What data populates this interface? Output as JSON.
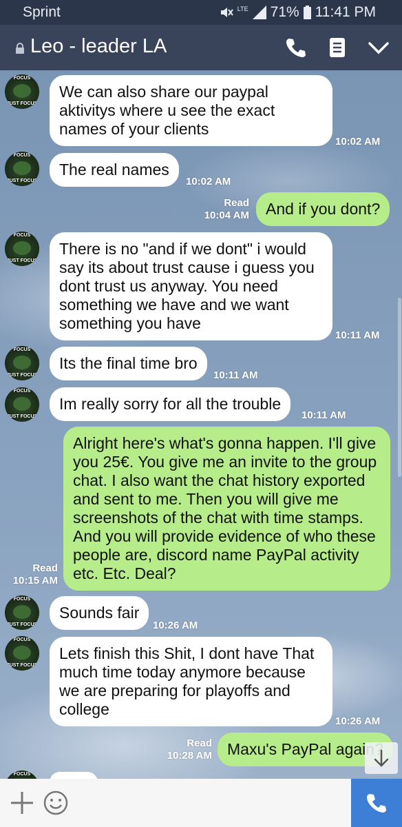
{
  "status_bar": {
    "carrier": "Sprint",
    "network": "LTE",
    "battery": "71%",
    "time": "11:41 PM"
  },
  "header": {
    "title": "Leo - leader LA",
    "icons": [
      "lock-icon",
      "phone-icon",
      "notes-icon",
      "chevron-down-icon"
    ]
  },
  "avatar": {
    "top_text": "FOCUS",
    "bottom_text": "JUST FOCUS"
  },
  "messages": [
    {
      "dir": "in",
      "text": "We can also share our paypal aktivitys where u see the exact names of your clients",
      "time": "10:02 AM"
    },
    {
      "dir": "in",
      "text": "The real names",
      "time": "10:02 AM"
    },
    {
      "dir": "out",
      "text": "And if you dont?",
      "read": "Read",
      "time": "10:04 AM"
    },
    {
      "dir": "in",
      "text": "There is no \"and if we dont\" i would say its about trust cause i guess you dont trust us anyway. You need something we have and we want something you have",
      "time": "10:11 AM"
    },
    {
      "dir": "in",
      "text": "Its the final time bro",
      "time": "10:11 AM"
    },
    {
      "dir": "in",
      "text": "Im really sorry for all the trouble",
      "time": "10:11 AM"
    },
    {
      "dir": "out",
      "text": "Alright here's what's gonna happen. I'll give you 25€.  You give me an invite to the group chat.  I also want the chat history exported and sent to me.  Then you will give me screenshots of the chat with time stamps.  And you will provide evidence of who these people are, discord name PayPal activity etc. Etc.  Deal?",
      "read": "Read",
      "time": "10:15 AM"
    },
    {
      "dir": "in",
      "text": "Sounds fair",
      "time": "10:26 AM"
    },
    {
      "dir": "in",
      "text": "Lets finish this Shit, I dont have That much time today anymore because we are preparing for playoffs and college",
      "time": "10:26 AM"
    },
    {
      "dir": "out",
      "text": "Maxu's PayPal again?",
      "read": "Read",
      "time": "10:28 AM"
    }
  ],
  "colors": {
    "header": "#39445a",
    "status": "#2b364a",
    "out_bubble": "#b6ec8a",
    "in_bubble": "#ffffff",
    "call_button": "#3d7fd6"
  },
  "input_bar": {
    "icons": [
      "plus-icon",
      "emoji-icon",
      "call-icon"
    ]
  }
}
